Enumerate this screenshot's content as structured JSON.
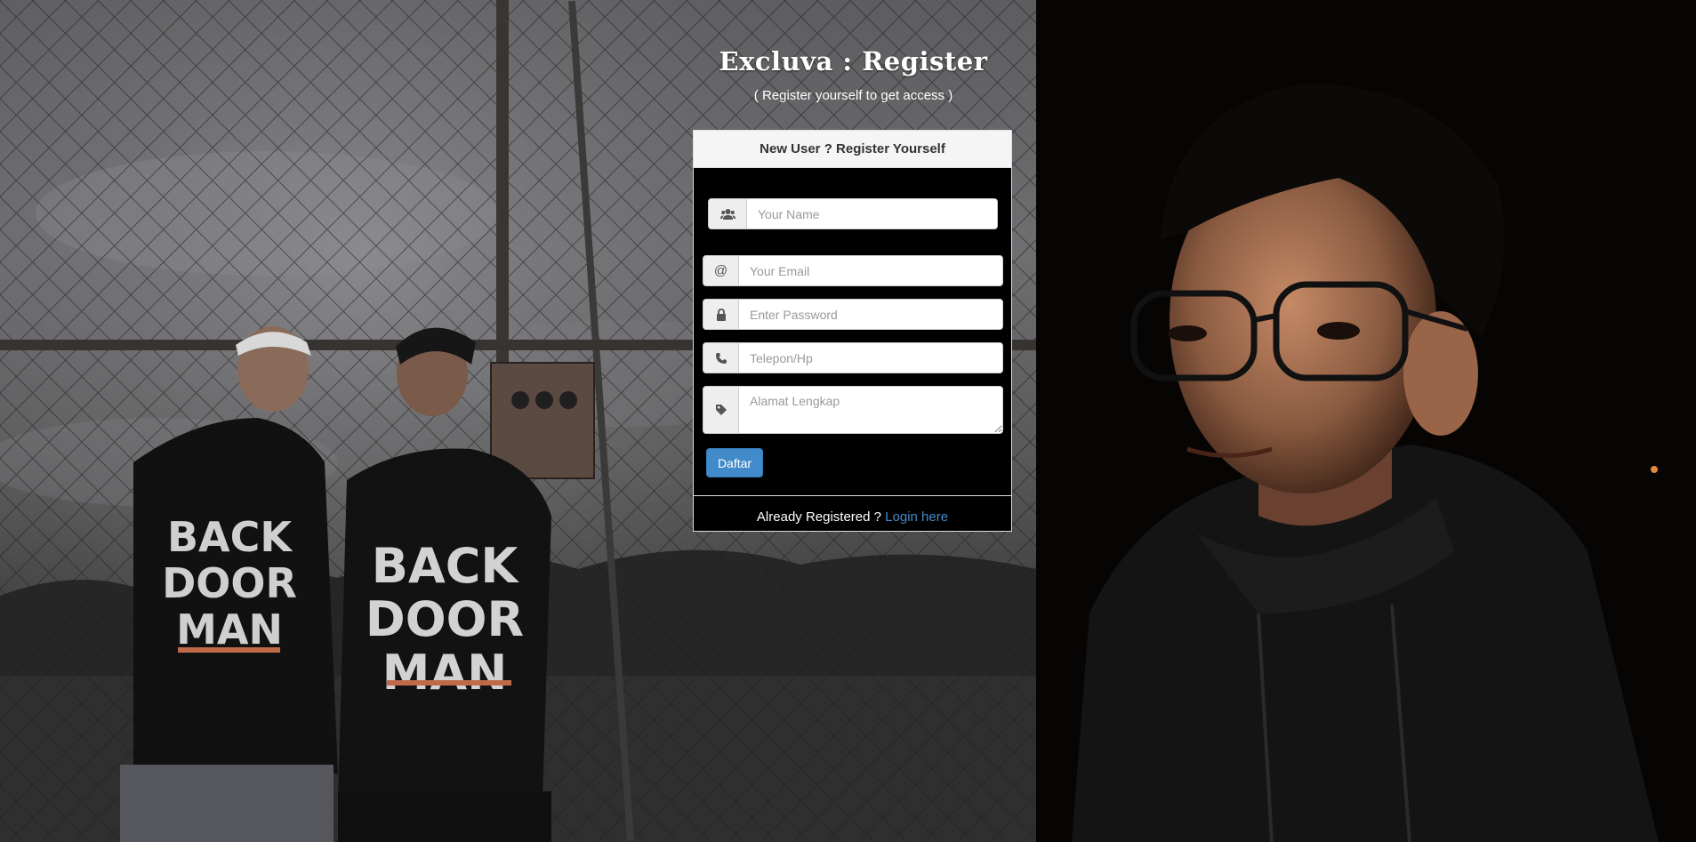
{
  "header": {
    "title": "Excluva : Register",
    "subtitle": "( Register yourself to get access )"
  },
  "panel": {
    "heading": "New User ? Register Yourself"
  },
  "form": {
    "name": {
      "placeholder": "Your Name",
      "value": "",
      "icon": "users-icon"
    },
    "email": {
      "placeholder": "Your Email",
      "value": "",
      "icon": "at-sign-icon",
      "addon_text": "@"
    },
    "password": {
      "placeholder": "Enter Password",
      "value": "",
      "icon": "lock-icon"
    },
    "phone": {
      "placeholder": "Telepon/Hp",
      "value": "",
      "icon": "phone-icon"
    },
    "address": {
      "placeholder": "Alamat Lengkap",
      "value": "",
      "icon": "tag-icon"
    },
    "submit_label": "Daftar"
  },
  "footer": {
    "prompt": "Already Registered ? ",
    "login_link": "Login here"
  },
  "background": {
    "left_shirt_text_1": "BACK",
    "left_shirt_text_2": "DOOR",
    "left_shirt_text_3": "MAN"
  },
  "colors": {
    "primary": "#428bca",
    "panel_heading_bg": "#f5f5f5",
    "panel_body_bg": "#000000"
  }
}
